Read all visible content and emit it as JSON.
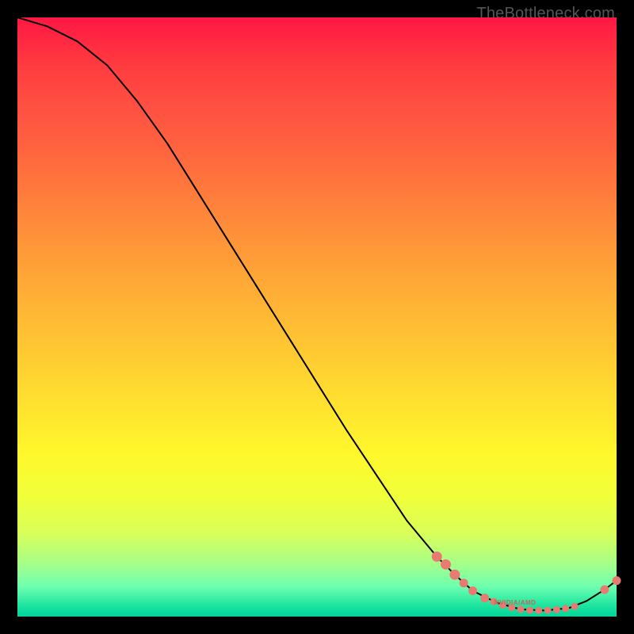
{
  "attribution": "TheBottleneck.com",
  "chart_data": {
    "type": "line",
    "title": "",
    "xlabel": "",
    "ylabel": "",
    "xlim": [
      0,
      100
    ],
    "ylim": [
      0,
      100
    ],
    "grid": false,
    "annotation": "NVIDIA/AMD",
    "legend": false,
    "curve": [
      {
        "x": 0,
        "y": 100
      },
      {
        "x": 5,
        "y": 98.5
      },
      {
        "x": 10,
        "y": 96
      },
      {
        "x": 15,
        "y": 92
      },
      {
        "x": 20,
        "y": 86
      },
      {
        "x": 25,
        "y": 79
      },
      {
        "x": 30,
        "y": 71
      },
      {
        "x": 35,
        "y": 63
      },
      {
        "x": 40,
        "y": 55
      },
      {
        "x": 45,
        "y": 47
      },
      {
        "x": 50,
        "y": 39
      },
      {
        "x": 55,
        "y": 31
      },
      {
        "x": 60,
        "y": 23.5
      },
      {
        "x": 65,
        "y": 16
      },
      {
        "x": 70,
        "y": 10
      },
      {
        "x": 73,
        "y": 7
      },
      {
        "x": 76,
        "y": 4.3
      },
      {
        "x": 80,
        "y": 2.3
      },
      {
        "x": 84,
        "y": 1.2
      },
      {
        "x": 88,
        "y": 1.0
      },
      {
        "x": 92,
        "y": 1.4
      },
      {
        "x": 95,
        "y": 2.6
      },
      {
        "x": 98,
        "y": 4.5
      },
      {
        "x": 100,
        "y": 6.0
      }
    ],
    "markers": [
      {
        "x": 70,
        "y": 10,
        "r": 6
      },
      {
        "x": 71.5,
        "y": 8.7,
        "r": 6
      },
      {
        "x": 73,
        "y": 7.0,
        "r": 6
      },
      {
        "x": 74.5,
        "y": 5.6,
        "r": 5
      },
      {
        "x": 76,
        "y": 4.3,
        "r": 5
      },
      {
        "x": 78,
        "y": 3.1,
        "r": 5
      },
      {
        "x": 79.5,
        "y": 2.5,
        "r": 4
      },
      {
        "x": 81,
        "y": 1.9,
        "r": 4
      },
      {
        "x": 82.5,
        "y": 1.5,
        "r": 4
      },
      {
        "x": 84,
        "y": 1.2,
        "r": 4
      },
      {
        "x": 85.5,
        "y": 1.05,
        "r": 4
      },
      {
        "x": 87,
        "y": 1.0,
        "r": 4
      },
      {
        "x": 88.5,
        "y": 1.05,
        "r": 4
      },
      {
        "x": 90,
        "y": 1.15,
        "r": 4
      },
      {
        "x": 91.5,
        "y": 1.35,
        "r": 4
      },
      {
        "x": 93,
        "y": 1.7,
        "r": 4
      },
      {
        "x": 98,
        "y": 4.5,
        "r": 5
      },
      {
        "x": 100,
        "y": 6.0,
        "r": 5
      }
    ]
  }
}
